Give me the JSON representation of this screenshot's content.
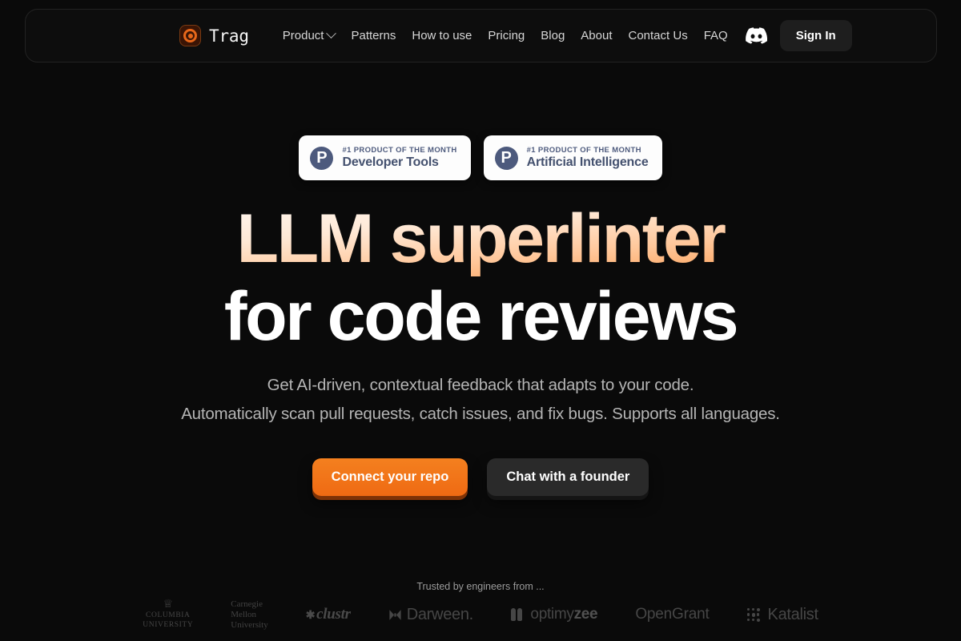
{
  "brand": {
    "name": "Trag",
    "logo_icon": "trag-ring-logo"
  },
  "nav": {
    "items": [
      {
        "label": "Product",
        "has_dropdown": true
      },
      {
        "label": "Patterns",
        "has_dropdown": false
      },
      {
        "label": "How to use",
        "has_dropdown": false
      },
      {
        "label": "Pricing",
        "has_dropdown": false
      },
      {
        "label": "Blog",
        "has_dropdown": false
      },
      {
        "label": "About",
        "has_dropdown": false
      },
      {
        "label": "Contact Us",
        "has_dropdown": false
      },
      {
        "label": "FAQ",
        "has_dropdown": false
      }
    ],
    "discord_icon": "discord-icon",
    "sign_in_label": "Sign In"
  },
  "badges": [
    {
      "kicker": "#1 PRODUCT OF THE MONTH",
      "title": "Developer Tools",
      "icon": "product-hunt-icon",
      "icon_letter": "P"
    },
    {
      "kicker": "#1 PRODUCT OF THE MONTH",
      "title": "Artificial Intelligence",
      "icon": "product-hunt-icon",
      "icon_letter": "P"
    }
  ],
  "hero": {
    "headline_line1": "LLM superlinter",
    "headline_line2": "for code reviews",
    "subtitle_line1": "Get AI-driven, contextual feedback that adapts to your code.",
    "subtitle_line2": "Automatically scan pull requests, catch issues, and fix bugs. Supports all languages.",
    "cta_primary": "Connect your repo",
    "cta_secondary": "Chat with a founder"
  },
  "trusted": {
    "label": "Trusted by engineers from ...",
    "logos": [
      {
        "name": "Columbia University",
        "line1": "COLUMBIA",
        "line2": "UNIVERSITY",
        "icon": "crown-icon"
      },
      {
        "name": "Carnegie Mellon University",
        "line1": "Carnegie",
        "line2": "Mellon",
        "line3": "University"
      },
      {
        "name": "clustr",
        "text": "clustr",
        "icon": "asterisk-icon"
      },
      {
        "name": "Darween",
        "text": "Darween.",
        "icon": "bowtie-icon"
      },
      {
        "name": "optimyzee",
        "text_light": "optimy",
        "text_bold": "zee",
        "icon": "pillars-icon"
      },
      {
        "name": "OpenGrant",
        "text": "OpenGrant"
      },
      {
        "name": "Katalist",
        "text": "Katalist",
        "icon": "dot-grid-icon"
      }
    ]
  },
  "colors": {
    "background": "#0a0a0a",
    "accent_orange": "#ef6a13",
    "navbar_bg": "#0d0d0d",
    "badge_bg": "#fdfdfd",
    "product_hunt": "#4d5a7d"
  }
}
